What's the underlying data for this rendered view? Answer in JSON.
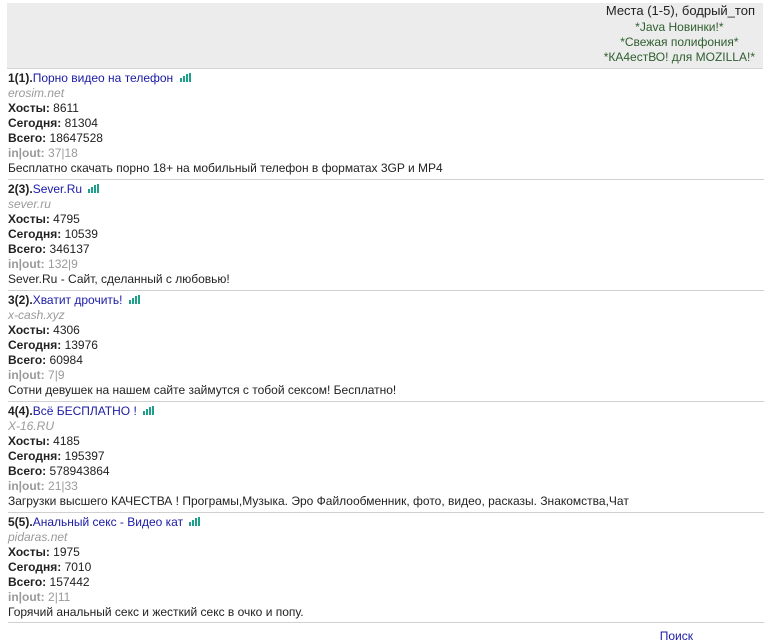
{
  "header": {
    "title": "Места (1-5), бодрый_топ",
    "links": [
      "*Java Новинки!*",
      "*Свежая полифония*",
      "*КА4естВО! для MOZILLA!*"
    ]
  },
  "labels": {
    "hosts": "Хосты:",
    "today": "Сегодня:",
    "total": "Всего:",
    "inout": "in|out:"
  },
  "entries": [
    {
      "rank": "1(1).",
      "title": "Порно видео на телефон",
      "domain": "erosim.net",
      "hosts": "8611",
      "today": "81304",
      "total": "18647528",
      "inout": "37|18",
      "description": "Бесплатно скачать порно 18+ на мобильный телефон в форматах 3GP и MP4"
    },
    {
      "rank": "2(3).",
      "title": "Sever.Ru",
      "domain": "sever.ru",
      "hosts": "4795",
      "today": "10539",
      "total": "346137",
      "inout": "132|9",
      "description": "Sever.Ru - Сайт, сделанный с любовью!"
    },
    {
      "rank": "3(2).",
      "title": "Хватит дрочить!",
      "domain": "x-cash.xyz",
      "hosts": "4306",
      "today": "13976",
      "total": "60984",
      "inout": "7|9",
      "description": "Сотни девушек на нашем сайте займутся с тобой сексом! Бесплатно!"
    },
    {
      "rank": "4(4).",
      "title": "Всё БЕСПЛАТНО !",
      "domain": "X-16.RU",
      "hosts": "4185",
      "today": "195397",
      "total": "578943864",
      "inout": "21|33",
      "description": "Загрузки высшего КАЧЕСТВА ! Програмы,Музыка. Эро Файлообменник, фото, видео, расказы. Знакомства,Чат"
    },
    {
      "rank": "5(5).",
      "title": "Анальный секс - Видео кат",
      "domain": "pidaras.net",
      "hosts": "1975",
      "today": "7010",
      "total": "157442",
      "inout": "2|11",
      "description": "Горячий анальный секс и жесткий секс в очко и попу."
    }
  ],
  "footer": {
    "search_label": "Поиск"
  },
  "icons": {
    "stats": "bar-chart-icon"
  },
  "colors": {
    "link": "#1a1aa6",
    "header_bg": "#ececec",
    "header_link": "#2e5e2e",
    "muted": "#9a9a9a",
    "stats_icon": "#1fa08a"
  }
}
